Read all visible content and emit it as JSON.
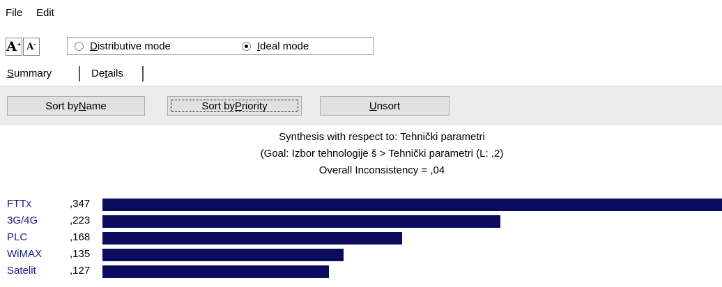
{
  "menu": {
    "file": "File",
    "edit": "Edit"
  },
  "toolbar": {
    "font_up_icon": "A",
    "font_down_icon": "A",
    "modes": [
      {
        "prefix": "",
        "accel": "D",
        "rest": "istributive mode",
        "checked": false
      },
      {
        "prefix": "",
        "accel": "I",
        "rest": "deal mode",
        "checked": true
      }
    ]
  },
  "tabs": [
    {
      "accel": "S",
      "rest": "ummary",
      "active": true
    },
    {
      "pre": "De",
      "accel": "t",
      "rest": "ails",
      "active": false
    }
  ],
  "buttons": {
    "sort_name": {
      "pre": "Sort by ",
      "accel": "N",
      "rest": "ame"
    },
    "sort_priority": {
      "pre": "Sort by ",
      "accel": "P",
      "rest": "riority"
    },
    "unsort": {
      "pre": "",
      "accel": "U",
      "rest": "nsort"
    }
  },
  "header": {
    "line1": "Synthesis with respect to: Tehnički parametri",
    "line2": "(Goal: Izbor tehnologije š > Tehnički parametri (L: ,2)",
    "line3": "Overall Inconsistency = ,04"
  },
  "colors": {
    "bar": "#0b0b5f",
    "name": "#1a1a8c"
  },
  "chart_data": {
    "type": "bar",
    "categories": [
      "FTTx",
      "3G/4G",
      "PLC",
      "WiMAX",
      "Satelit"
    ],
    "value_labels": [
      ",347",
      ",223",
      ",168",
      ",135",
      ",127"
    ],
    "values": [
      0.347,
      0.223,
      0.168,
      0.135,
      0.127
    ]
  }
}
